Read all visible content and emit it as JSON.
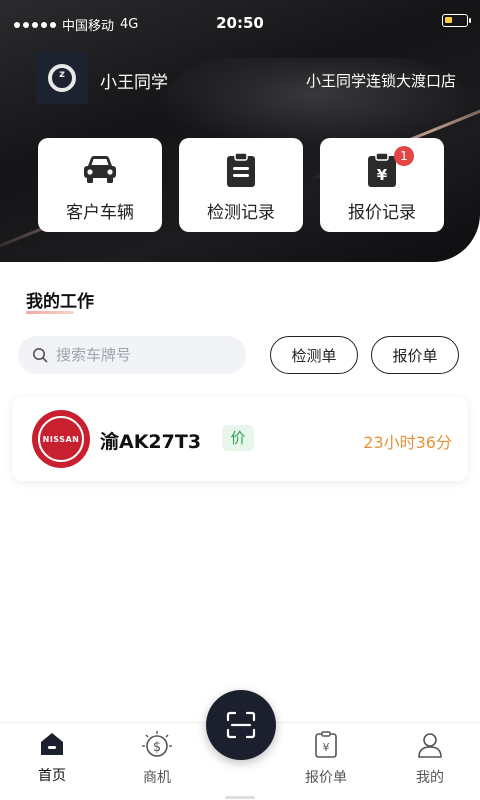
{
  "status_bar": {
    "carrier": "中国移动",
    "network": "4G",
    "time": "20:50"
  },
  "header": {
    "username": "小王同学",
    "store_name": "小王同学连锁大渡口店"
  },
  "quick_actions": [
    {
      "label": "客户车辆",
      "icon": "car-icon"
    },
    {
      "label": "检测记录",
      "icon": "clipboard-list-icon"
    },
    {
      "label": "报价记录",
      "icon": "clipboard-yen-icon",
      "badge": "1"
    }
  ],
  "work": {
    "title": "我的工作",
    "search_placeholder": "搜索车牌号",
    "filters": [
      "检测单",
      "报价单"
    ],
    "items": [
      {
        "brand": "NISSAN",
        "plate": "渝AK27T3",
        "tag": "价",
        "remaining": "23小时36分"
      }
    ]
  },
  "tabbar": {
    "tabs": [
      {
        "label": "首页",
        "icon": "home-icon",
        "active": true
      },
      {
        "label": "商机",
        "icon": "dollar-coin-icon",
        "active": false
      },
      {
        "label": "报价单",
        "icon": "quote-doc-icon",
        "active": false
      },
      {
        "label": "我的",
        "icon": "user-icon",
        "active": false
      }
    ],
    "center_icon": "scan-icon"
  },
  "colors": {
    "accent_orange": "#e8913a",
    "tag_green": "#2fa34f",
    "badge_red": "#e44545",
    "nissan_red": "#c8202f",
    "dark_navy": "#1c1f2e"
  }
}
